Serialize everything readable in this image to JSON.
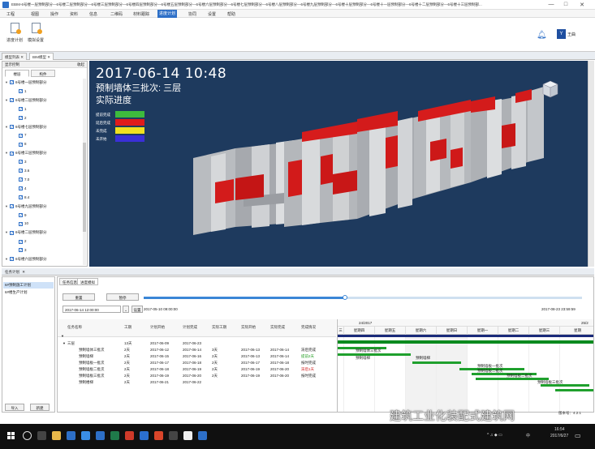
{
  "window": {
    "title": "EBIM-6号楼一层预制部分—6号楼二层预制部分—6号楼三层预制部分—6号楼四层预制部分—6号楼五层预制部分—6号楼六层预制部分—6号楼七层预制部分—6号楼八层预制部分—6号楼九层预制部分—6号楼十层预制部分—6号楼十一层预制部分—6号楼十二层预制部分—6号楼十三层预制部...",
    "min": "—",
    "max": "□",
    "close": "✕"
  },
  "menu": [
    "工程",
    "视图",
    "操作",
    "资料",
    "信息",
    "二维码",
    "材料跟踪",
    "进度计划",
    "协同",
    "设置",
    "帮助"
  ],
  "menu_active_index": 7,
  "ribbon": {
    "buttons": [
      "进度计划",
      "模拟设置"
    ],
    "user": "王曲",
    "user_initial": "Y"
  },
  "doc_tabs": [
    "模型列表",
    "BIM模型"
  ],
  "doc_tab_close": "✕",
  "left_panel": {
    "header": "显示控制",
    "header_right": "收起",
    "tabs": [
      "楼层",
      "构件"
    ],
    "tree": [
      {
        "level": 0,
        "label": "6号楼一层预制部分"
      },
      {
        "level": 1,
        "label": "1"
      },
      {
        "level": 0,
        "label": "6号楼二层预制部分"
      },
      {
        "level": 1,
        "label": "1"
      },
      {
        "level": 1,
        "label": "2"
      },
      {
        "level": 0,
        "label": "6号楼七层预制部分"
      },
      {
        "level": 1,
        "label": "7"
      },
      {
        "level": 1,
        "label": "8"
      },
      {
        "level": 0,
        "label": "6号楼三层预制部分"
      },
      {
        "level": 1,
        "label": "3"
      },
      {
        "level": 1,
        "label": "3.6"
      },
      {
        "level": 1,
        "label": "7.0"
      },
      {
        "level": 1,
        "label": "4"
      },
      {
        "level": 1,
        "label": "8.4"
      },
      {
        "level": 0,
        "label": "6号楼九层预制部分"
      },
      {
        "level": 1,
        "label": "9"
      },
      {
        "level": 1,
        "label": "10"
      },
      {
        "level": 0,
        "label": "6号楼二层预制部分"
      },
      {
        "level": 1,
        "label": "2"
      },
      {
        "level": 1,
        "label": "3"
      },
      {
        "level": 0,
        "label": "6号楼六层预制部分"
      }
    ]
  },
  "scene": {
    "time": "2017-06-14  10:48",
    "batch": "预制墙体三批次: 三层",
    "mode": "实际进度",
    "legend": [
      {
        "label": "提前完成",
        "color": "#3dbb3d"
      },
      {
        "label": "延后完成",
        "color": "#e01b1b"
      },
      {
        "label": "未完成",
        "color": "#f0e020"
      },
      {
        "label": "未开始",
        "color": "#3a2fd8"
      }
    ]
  },
  "bottom": {
    "title": "任务计划",
    "title_close": "✕",
    "task_list": [
      "6#预制施工计划",
      "6#楼生产计划"
    ],
    "task_buttons": [
      "导入",
      "新建"
    ],
    "tabs": [
      "任务信息",
      "进度模拟"
    ],
    "controls": {
      "reset": "重置",
      "pause": "暂停",
      "set": "设置",
      "current_time": "2017-06-14 12:00:00",
      "start_time": "2017-05-10 09:00:00",
      "end_time": "2017-08-23 23:59:59",
      "progress": 0.46
    },
    "columns": [
      "任务名称",
      "工期",
      "计划开始",
      "计划完成",
      "实际工期",
      "实际开始",
      "实际完成",
      "完成情况"
    ],
    "rows": [
      {
        "name": "三层",
        "dur": "13天",
        "ps": "2017-06-09",
        "pe": "2017-06-23",
        "ad": "",
        "as": "",
        "ae": "",
        "st": "",
        "indent": 1
      },
      {
        "name": "预制墙体三批次",
        "dur": "2天",
        "ps": "2017-06-12",
        "pe": "2017-06-14",
        "ad": "3天",
        "as": "2017-06-13",
        "ae": "2017-06-14",
        "st": "滞后完成",
        "st_color": "#222",
        "indent": 2
      },
      {
        "name": "预制墙梯",
        "dur": "2天",
        "ps": "2017-06-15",
        "pe": "2017-06-16",
        "ad": "2天",
        "as": "2017-06-13",
        "ae": "2017-06-14",
        "st": "提前2天",
        "st_color": "#1a9a1a",
        "indent": 2
      },
      {
        "name": "预制墙板一批次",
        "dur": "2天",
        "ps": "2017-06-17",
        "pe": "2017-06-18",
        "ad": "2天",
        "as": "2017-06-17",
        "ae": "2017-06-18",
        "st": "按时完成",
        "st_color": "#222",
        "indent": 2
      },
      {
        "name": "预制墙板二批次",
        "dur": "2天",
        "ps": "2017-06-18",
        "pe": "2017-06-19",
        "ad": "2天",
        "as": "2017-06-19",
        "ae": "2017-06-20",
        "st": "滞后1天",
        "st_color": "#d02020",
        "indent": 2
      },
      {
        "name": "预制墙板三批次",
        "dur": "2天",
        "ps": "2017-06-19",
        "pe": "2017-06-20",
        "ad": "2天",
        "as": "2017-06-19",
        "ae": "2017-06-20",
        "st": "按时完成",
        "st_color": "#222",
        "indent": 2
      },
      {
        "name": "预制楼梯",
        "dur": "2天",
        "ps": "2017-06-21",
        "pe": "2017-06-22",
        "ad": "",
        "as": "",
        "ae": "",
        "st": "",
        "indent": 2
      }
    ],
    "gantt": {
      "week_left": "24/2017",
      "week_right": "25/2",
      "days": [
        "三",
        "星期四",
        "星期五",
        "星期六",
        "星期日",
        "星期一",
        "星期二",
        "星期三",
        "星期"
      ],
      "bar_labels": [
        "预制墙体三批次",
        "预制墙梯",
        "预制墙梯",
        "预制墙板一批次",
        "预制墙板二批次",
        "预制墙板二批次",
        "预制墙板三批次"
      ]
    }
  },
  "taskbar": {
    "time": "16:54",
    "date": "2017/6/27",
    "lang": "中",
    "build": "版本号：4.2.1"
  },
  "watermark": "建筑工业化装配式建筑网"
}
